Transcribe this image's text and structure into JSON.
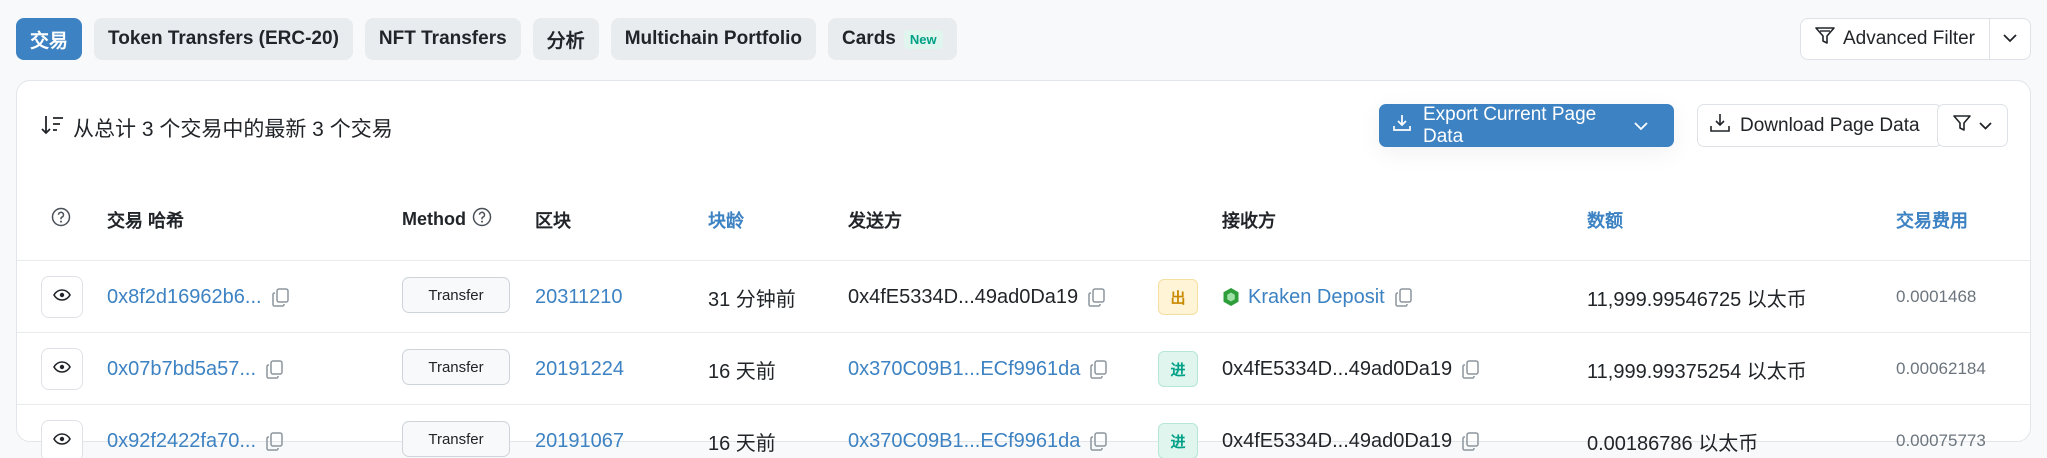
{
  "tabs": [
    {
      "label": "交易",
      "active": true
    },
    {
      "label": "Token Transfers (ERC-20)",
      "active": false
    },
    {
      "label": "NFT Transfers",
      "active": false
    },
    {
      "label": "分析",
      "active": false
    },
    {
      "label": "Multichain Portfolio",
      "active": false
    },
    {
      "label": "Cards",
      "active": false,
      "badge": "New"
    }
  ],
  "advanced_filter_label": "Advanced Filter",
  "summary_text": "从总计 3 个交易中的最新 3 个交易",
  "export_label": "Export Current Page Data",
  "download_label": "Download Page Data",
  "columns": {
    "tx_hash": "交易 哈希",
    "method": "Method",
    "block": "区块",
    "age": "块龄",
    "from": "发送方",
    "to": "接收方",
    "value": "数额",
    "fee": "交易费用"
  },
  "rows": [
    {
      "tx_hash": "0x8f2d16962b6...",
      "method": "Transfer",
      "block": "20311210",
      "age": "31 分钟前",
      "from": "0x4fE5334D...49ad0Da19",
      "from_is_link": false,
      "direction": "出",
      "direction_type": "out",
      "to": "Kraken Deposit",
      "to_is_link": true,
      "to_has_icon": true,
      "value": "11,999.99546725 以太币",
      "fee": "0.0001468"
    },
    {
      "tx_hash": "0x07b7bd5a57...",
      "method": "Transfer",
      "block": "20191224",
      "age": "16 天前",
      "from": "0x370C09B1...ECf9961da",
      "from_is_link": true,
      "direction": "进",
      "direction_type": "in",
      "to": "0x4fE5334D...49ad0Da19",
      "to_is_link": false,
      "to_has_icon": false,
      "value": "11,999.99375254 以太币",
      "fee": "0.00062184"
    },
    {
      "tx_hash": "0x92f2422fa70...",
      "method": "Transfer",
      "block": "20191067",
      "age": "16 天前",
      "from": "0x370C09B1...ECf9961da",
      "from_is_link": true,
      "direction": "进",
      "direction_type": "in",
      "to": "0x4fE5334D...49ad0Da19",
      "to_is_link": false,
      "to_has_icon": false,
      "value": "0.00186786 以太币",
      "fee": "0.00075773"
    }
  ],
  "colors": {
    "accent": "#3d82c2",
    "out_badge": "#c98a00",
    "in_badge": "#00a186",
    "kraken_icon": "#2e9e3a"
  },
  "icons": [
    "eye-icon",
    "copy-icon",
    "sort-icon",
    "help-circle-icon",
    "download-icon",
    "filter-icon",
    "chevron-down-icon",
    "kraken-icon"
  ]
}
